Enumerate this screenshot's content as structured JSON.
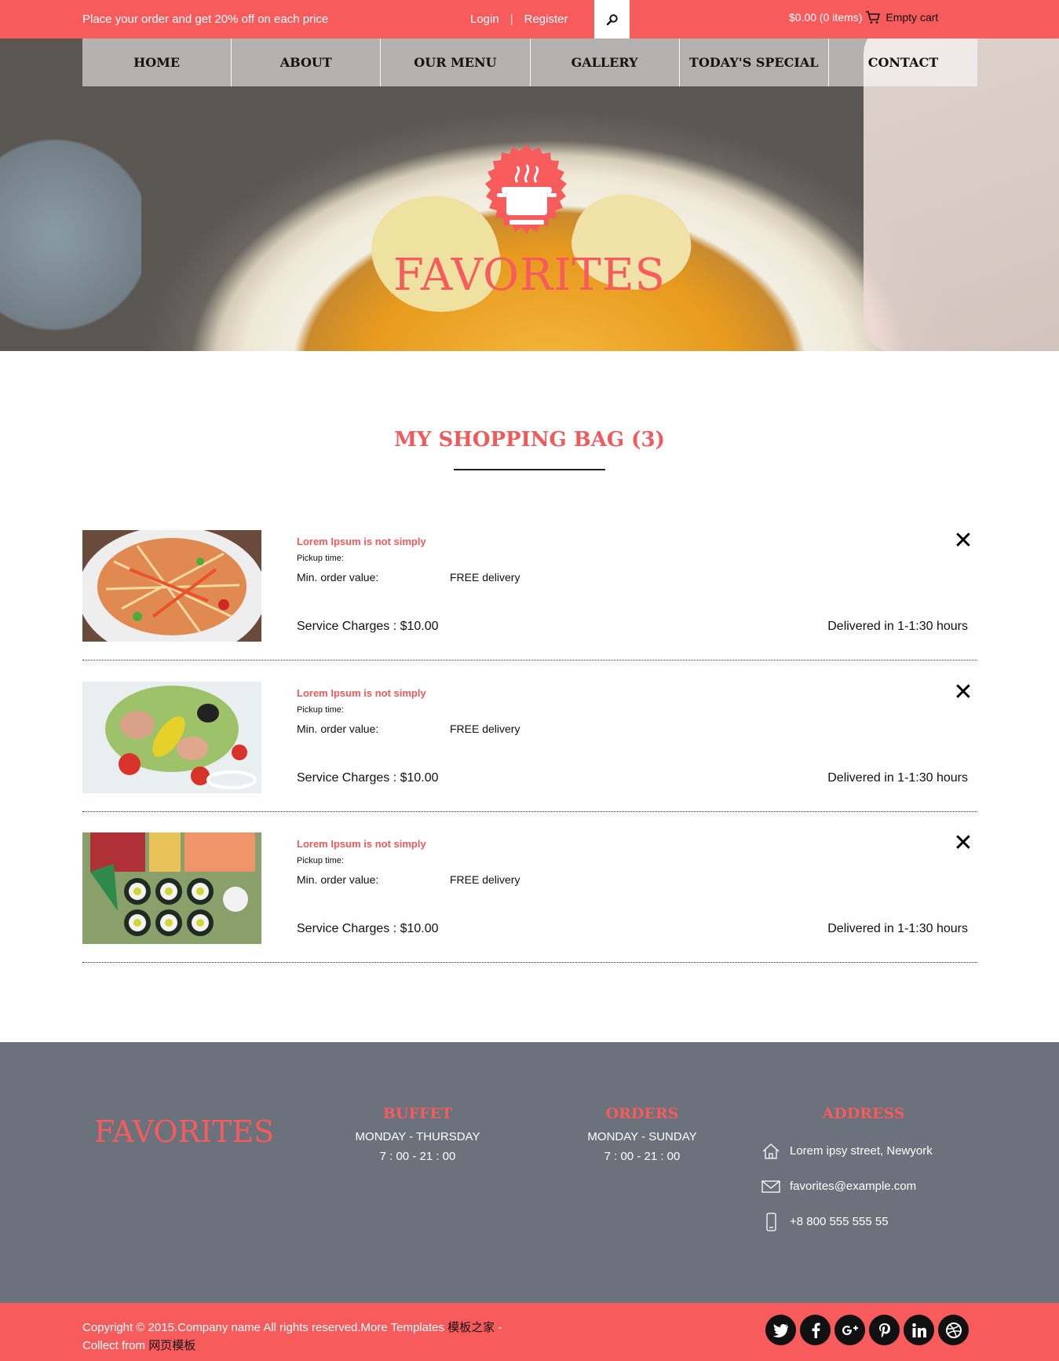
{
  "topbar": {
    "promo": "Place your order and get 20% off on each price",
    "login": "Login",
    "separator": "|",
    "register": "Register",
    "search_icon": "search-icon",
    "cart_total": "$0.00 (0 items)",
    "cart_icon": "cart-icon",
    "cart_empty": "Empty cart"
  },
  "nav": {
    "items": [
      "HOME",
      "ABOUT",
      "OUR MENU",
      "GALLERY",
      "TODAY'S SPECIAL",
      "CONTACT"
    ]
  },
  "hero": {
    "logo_icon": "cooking-pot-icon",
    "title": "FAVORITES"
  },
  "bag": {
    "title": "MY SHOPPING BAG (3)",
    "items": [
      {
        "image_icon": "food-image",
        "name": "Lorem Ipsum is not simply",
        "pickup_label": "Pickup time:",
        "min_order_label": "Min. order value:",
        "delivery": "FREE delivery",
        "service": "Service Charges : $10.00",
        "eta": "Delivered in 1-1:30 hours",
        "remove_icon": "close-icon"
      },
      {
        "image_icon": "food-image",
        "name": "Lorem Ipsum is not simply",
        "pickup_label": "Pickup time:",
        "min_order_label": "Min. order value:",
        "delivery": "FREE delivery",
        "service": "Service Charges : $10.00",
        "eta": "Delivered in 1-1:30 hours",
        "remove_icon": "close-icon"
      },
      {
        "image_icon": "food-image",
        "name": "Lorem Ipsum is not simply",
        "pickup_label": "Pickup time:",
        "min_order_label": "Min. order value:",
        "delivery": "FREE delivery",
        "service": "Service Charges : $10.00",
        "eta": "Delivered in 1-1:30 hours",
        "remove_icon": "close-icon"
      }
    ]
  },
  "footer": {
    "brand": "FAVORITES",
    "buffet": {
      "title": "BUFFET",
      "days": "MONDAY - THURSDAY",
      "hours": "7 : 00 - 21 : 00"
    },
    "orders": {
      "title": "ORDERS",
      "days": "MONDAY - SUNDAY",
      "hours": "7 : 00 - 21 : 00"
    },
    "address": {
      "title": "ADDRESS",
      "street": "Lorem ipsy street, Newyork",
      "email": "favorites@example.com",
      "phone": "+8 800 555 555 55"
    }
  },
  "bottom": {
    "copyright": "Copyright © 2015.Company name All rights reserved.More Templates ",
    "link1": "模板之家",
    "dash": " -",
    "collect": "Collect from ",
    "link2": "网页模板",
    "social": [
      "twitter-icon",
      "facebook-icon",
      "google-plus-icon",
      "pinterest-icon",
      "linkedin-icon",
      "dribbble-icon"
    ]
  },
  "colors": {
    "accent": "#f75b5c",
    "footer_bg": "#6b727c",
    "text": "#111111"
  }
}
